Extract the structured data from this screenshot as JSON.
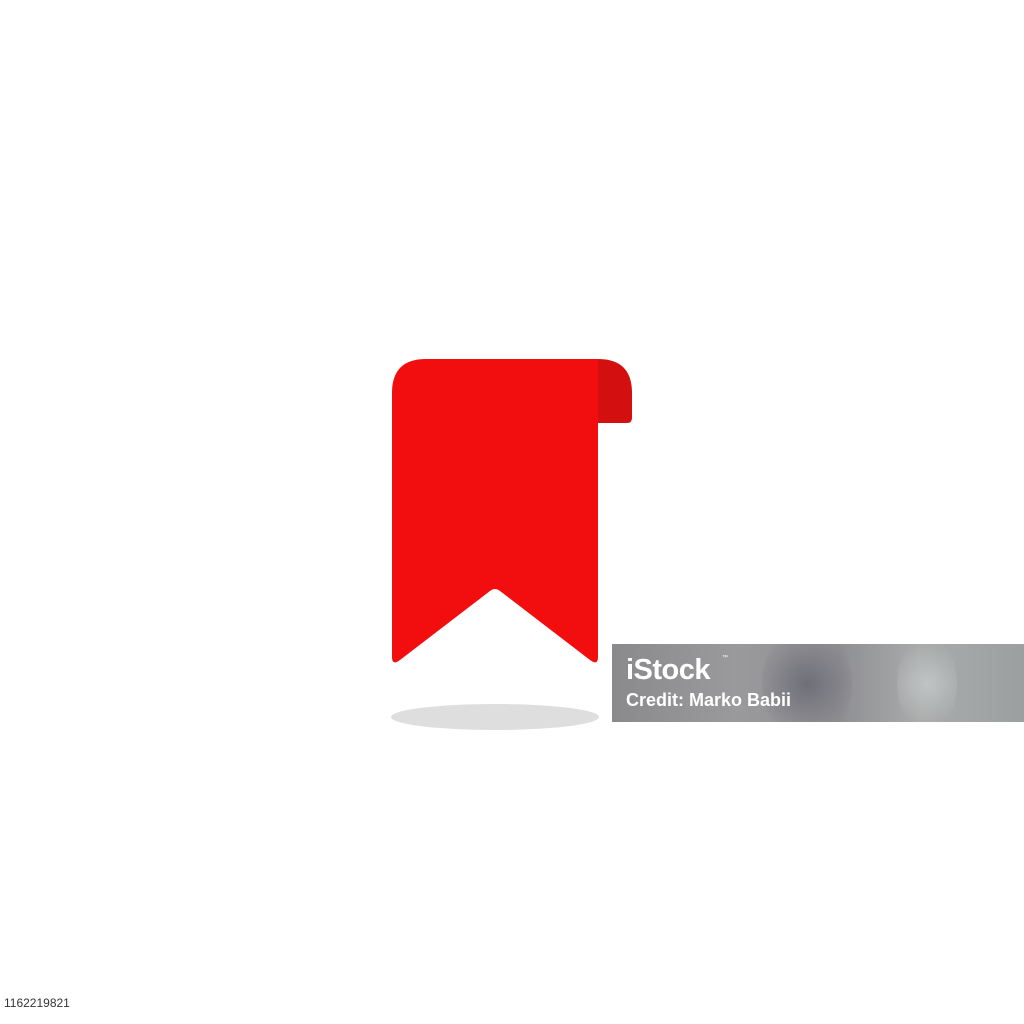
{
  "watermark": {
    "brand": "iStock",
    "trademark": "™",
    "credit": "Credit: Marko Babii"
  },
  "image_id": "1162219821",
  "colors": {
    "bookmark": "#f20e0e",
    "bookmark_fold": "#d40f0f",
    "shadow": "#dedede",
    "background": "#ffffff"
  },
  "icon": "bookmark-icon"
}
